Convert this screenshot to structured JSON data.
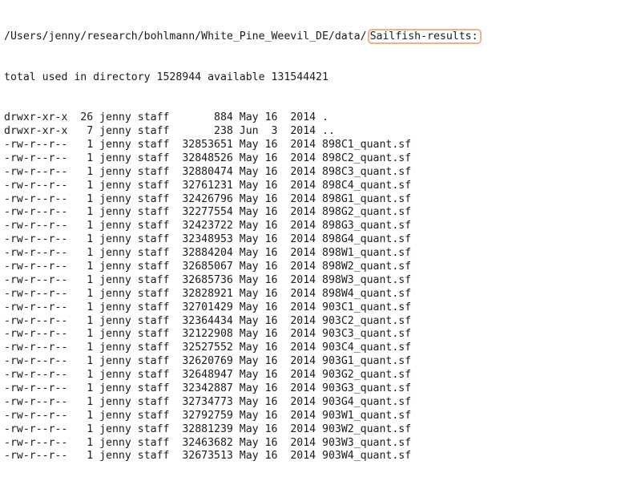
{
  "path": {
    "prefix": "/Users/jenny/research/bohlmann/White_Pine_Weevil_DE/data/",
    "highlighted": "Sailfish-results:"
  },
  "summary": "total used in directory 1528944 available 131544421",
  "listing": [
    {
      "perms": "drwxr-xr-x",
      "links": "26",
      "owner": "jenny",
      "group": "staff",
      "size": "884",
      "month": "May",
      "day": "16",
      "year": "2014",
      "name": "."
    },
    {
      "perms": "drwxr-xr-x",
      "links": "7",
      "owner": "jenny",
      "group": "staff",
      "size": "238",
      "month": "Jun",
      "day": "3",
      "year": "2014",
      "name": ".."
    },
    {
      "perms": "-rw-r--r--",
      "links": "1",
      "owner": "jenny",
      "group": "staff",
      "size": "32853651",
      "month": "May",
      "day": "16",
      "year": "2014",
      "name": "898C1_quant.sf"
    },
    {
      "perms": "-rw-r--r--",
      "links": "1",
      "owner": "jenny",
      "group": "staff",
      "size": "32848526",
      "month": "May",
      "day": "16",
      "year": "2014",
      "name": "898C2_quant.sf"
    },
    {
      "perms": "-rw-r--r--",
      "links": "1",
      "owner": "jenny",
      "group": "staff",
      "size": "32880474",
      "month": "May",
      "day": "16",
      "year": "2014",
      "name": "898C3_quant.sf"
    },
    {
      "perms": "-rw-r--r--",
      "links": "1",
      "owner": "jenny",
      "group": "staff",
      "size": "32761231",
      "month": "May",
      "day": "16",
      "year": "2014",
      "name": "898C4_quant.sf"
    },
    {
      "perms": "-rw-r--r--",
      "links": "1",
      "owner": "jenny",
      "group": "staff",
      "size": "32426796",
      "month": "May",
      "day": "16",
      "year": "2014",
      "name": "898G1_quant.sf"
    },
    {
      "perms": "-rw-r--r--",
      "links": "1",
      "owner": "jenny",
      "group": "staff",
      "size": "32277554",
      "month": "May",
      "day": "16",
      "year": "2014",
      "name": "898G2_quant.sf"
    },
    {
      "perms": "-rw-r--r--",
      "links": "1",
      "owner": "jenny",
      "group": "staff",
      "size": "32423722",
      "month": "May",
      "day": "16",
      "year": "2014",
      "name": "898G3_quant.sf"
    },
    {
      "perms": "-rw-r--r--",
      "links": "1",
      "owner": "jenny",
      "group": "staff",
      "size": "32348953",
      "month": "May",
      "day": "16",
      "year": "2014",
      "name": "898G4_quant.sf"
    },
    {
      "perms": "-rw-r--r--",
      "links": "1",
      "owner": "jenny",
      "group": "staff",
      "size": "32884204",
      "month": "May",
      "day": "16",
      "year": "2014",
      "name": "898W1_quant.sf"
    },
    {
      "perms": "-rw-r--r--",
      "links": "1",
      "owner": "jenny",
      "group": "staff",
      "size": "32685067",
      "month": "May",
      "day": "16",
      "year": "2014",
      "name": "898W2_quant.sf"
    },
    {
      "perms": "-rw-r--r--",
      "links": "1",
      "owner": "jenny",
      "group": "staff",
      "size": "32685736",
      "month": "May",
      "day": "16",
      "year": "2014",
      "name": "898W3_quant.sf"
    },
    {
      "perms": "-rw-r--r--",
      "links": "1",
      "owner": "jenny",
      "group": "staff",
      "size": "32828921",
      "month": "May",
      "day": "16",
      "year": "2014",
      "name": "898W4_quant.sf"
    },
    {
      "perms": "-rw-r--r--",
      "links": "1",
      "owner": "jenny",
      "group": "staff",
      "size": "32701429",
      "month": "May",
      "day": "16",
      "year": "2014",
      "name": "903C1_quant.sf"
    },
    {
      "perms": "-rw-r--r--",
      "links": "1",
      "owner": "jenny",
      "group": "staff",
      "size": "32364434",
      "month": "May",
      "day": "16",
      "year": "2014",
      "name": "903C2_quant.sf"
    },
    {
      "perms": "-rw-r--r--",
      "links": "1",
      "owner": "jenny",
      "group": "staff",
      "size": "32122908",
      "month": "May",
      "day": "16",
      "year": "2014",
      "name": "903C3_quant.sf"
    },
    {
      "perms": "-rw-r--r--",
      "links": "1",
      "owner": "jenny",
      "group": "staff",
      "size": "32527552",
      "month": "May",
      "day": "16",
      "year": "2014",
      "name": "903C4_quant.sf"
    },
    {
      "perms": "-rw-r--r--",
      "links": "1",
      "owner": "jenny",
      "group": "staff",
      "size": "32620769",
      "month": "May",
      "day": "16",
      "year": "2014",
      "name": "903G1_quant.sf"
    },
    {
      "perms": "-rw-r--r--",
      "links": "1",
      "owner": "jenny",
      "group": "staff",
      "size": "32648947",
      "month": "May",
      "day": "16",
      "year": "2014",
      "name": "903G2_quant.sf"
    },
    {
      "perms": "-rw-r--r--",
      "links": "1",
      "owner": "jenny",
      "group": "staff",
      "size": "32342887",
      "month": "May",
      "day": "16",
      "year": "2014",
      "name": "903G3_quant.sf"
    },
    {
      "perms": "-rw-r--r--",
      "links": "1",
      "owner": "jenny",
      "group": "staff",
      "size": "32734773",
      "month": "May",
      "day": "16",
      "year": "2014",
      "name": "903G4_quant.sf"
    },
    {
      "perms": "-rw-r--r--",
      "links": "1",
      "owner": "jenny",
      "group": "staff",
      "size": "32792759",
      "month": "May",
      "day": "16",
      "year": "2014",
      "name": "903W1_quant.sf"
    },
    {
      "perms": "-rw-r--r--",
      "links": "1",
      "owner": "jenny",
      "group": "staff",
      "size": "32881239",
      "month": "May",
      "day": "16",
      "year": "2014",
      "name": "903W2_quant.sf"
    },
    {
      "perms": "-rw-r--r--",
      "links": "1",
      "owner": "jenny",
      "group": "staff",
      "size": "32463682",
      "month": "May",
      "day": "16",
      "year": "2014",
      "name": "903W3_quant.sf"
    },
    {
      "perms": "-rw-r--r--",
      "links": "1",
      "owner": "jenny",
      "group": "staff",
      "size": "32673513",
      "month": "May",
      "day": "16",
      "year": "2014",
      "name": "903W4_quant.sf"
    }
  ],
  "colors": {
    "highlight_border": "#f0b08e",
    "text": "#1a1a1a",
    "background": "#ffffff"
  }
}
